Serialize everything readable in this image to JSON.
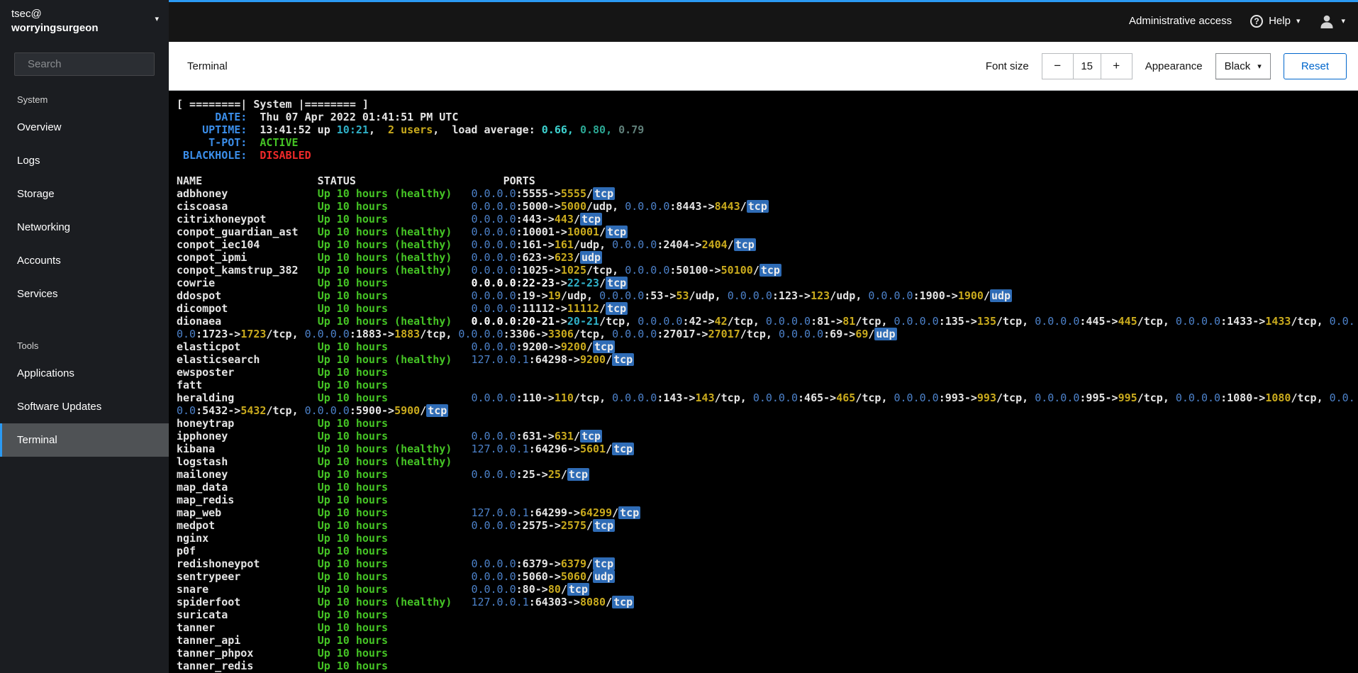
{
  "masthead": {
    "admin_access": "Administrative access",
    "help_label": "Help"
  },
  "sidebar": {
    "host": {
      "user": "tsec@",
      "name": "worryingsurgeon"
    },
    "search_placeholder": "Search",
    "active_item": "Terminal",
    "sections": [
      {
        "label": "System",
        "items": [
          "Overview",
          "Logs",
          "Storage",
          "Networking",
          "Accounts",
          "Services"
        ]
      },
      {
        "label": "Tools",
        "items": [
          "Applications",
          "Software Updates",
          "Terminal"
        ]
      }
    ]
  },
  "toolbar": {
    "title": "Terminal",
    "font_size_label": "Font size",
    "decrease_icon": "−",
    "increase_icon": "+",
    "font_size_value": "15",
    "appearance_label": "Appearance",
    "appearance_value": "Black",
    "reset_label": "Reset"
  },
  "terminal": {
    "banner": "[ ========| System |======== ]",
    "info_rows": [
      {
        "label": "DATE:",
        "segments": [
          {
            "t": "Thu 07 Apr 2022 01:41:51 PM UTC",
            "c": "fg"
          }
        ]
      },
      {
        "label": "UPTIME:",
        "segments": [
          {
            "t": "13:41:52 up ",
            "c": "fg"
          },
          {
            "t": "10:21",
            "c": "cyan"
          },
          {
            "t": ",  ",
            "c": "fg"
          },
          {
            "t": "2 users",
            "c": "yellow"
          },
          {
            "t": ",  load average: ",
            "c": "fg"
          },
          {
            "t": "0.66,",
            "c": "loadA"
          },
          {
            "t": " ",
            "c": "fg"
          },
          {
            "t": "0.80,",
            "c": "loadB"
          },
          {
            "t": " ",
            "c": "fg"
          },
          {
            "t": "0.79",
            "c": "loadC"
          }
        ]
      },
      {
        "label": "T-POT:",
        "segments": [
          {
            "t": "ACTIVE",
            "c": "green"
          }
        ]
      },
      {
        "label": "BLACKHOLE:",
        "segments": [
          {
            "t": "DISABLED",
            "c": "red"
          }
        ]
      }
    ],
    "columns": {
      "name": "NAME",
      "status": "STATUS",
      "ports": "PORTS"
    },
    "containers": [
      {
        "name": "adbhoney",
        "status": "Up 10 hours (healthy)",
        "ports": "0.0.0.0:5555->5555/tcp"
      },
      {
        "name": "ciscoasa",
        "status": "Up 10 hours",
        "ports": "0.0.0.0:5000->5000/udp, 0.0.0.0:8443->8443/tcp"
      },
      {
        "name": "citrixhoneypot",
        "status": "Up 10 hours",
        "ports": "0.0.0.0:443->443/tcp"
      },
      {
        "name": "conpot_guardian_ast",
        "status": "Up 10 hours (healthy)",
        "ports": "0.0.0.0:10001->10001/tcp"
      },
      {
        "name": "conpot_iec104",
        "status": "Up 10 hours (healthy)",
        "ports": "0.0.0.0:161->161/udp, 0.0.0.0:2404->2404/tcp"
      },
      {
        "name": "conpot_ipmi",
        "status": "Up 10 hours (healthy)",
        "ports": "0.0.0.0:623->623/udp"
      },
      {
        "name": "conpot_kamstrup_382",
        "status": "Up 10 hours (healthy)",
        "ports": "0.0.0.0:1025->1025/tcp, 0.0.0.0:50100->50100/tcp"
      },
      {
        "name": "cowrie",
        "status": "Up 10 hours",
        "ports": "0.0.0.0:22-23->22-23/tcp"
      },
      {
        "name": "ddospot",
        "status": "Up 10 hours",
        "ports": "0.0.0.0:19->19/udp, 0.0.0.0:53->53/udp, 0.0.0.0:123->123/udp, 0.0.0.0:1900->1900/udp"
      },
      {
        "name": "dicompot",
        "status": "Up 10 hours",
        "ports": "0.0.0.0:11112->11112/tcp"
      },
      {
        "name": "dionaea",
        "status": "Up 10 hours (healthy)",
        "ports": "0.0.0.0:20-21->20-21/tcp, 0.0.0.0:42->42/tcp, 0.0.0.0:81->81/tcp, 0.0.0.0:135->135/tcp, 0.0.0.0:445->445/tcp, 0.0.0.0:1433->1433/tcp, 0.0.0.0:1723->1723/tcp, 0.0.0.0:1883->1883/tcp, 0.0.0.0:3306->3306/tcp, 0.0.0.0:27017->27017/tcp, 0.0.0.0:69->69/udp"
      },
      {
        "name": "elasticpot",
        "status": "Up 10 hours",
        "ports": "0.0.0.0:9200->9200/tcp"
      },
      {
        "name": "elasticsearch",
        "status": "Up 10 hours (healthy)",
        "ports": "127.0.0.1:64298->9200/tcp"
      },
      {
        "name": "ewsposter",
        "status": "Up 10 hours",
        "ports": ""
      },
      {
        "name": "fatt",
        "status": "Up 10 hours",
        "ports": ""
      },
      {
        "name": "heralding",
        "status": "Up 10 hours",
        "ports": "0.0.0.0:110->110/tcp, 0.0.0.0:143->143/tcp, 0.0.0.0:465->465/tcp, 0.0.0.0:993->993/tcp, 0.0.0.0:995->995/tcp, 0.0.0.0:1080->1080/tcp, 0.0.0.0:5432->5432/tcp, 0.0.0.0:5900->5900/tcp"
      },
      {
        "name": "honeytrap",
        "status": "Up 10 hours",
        "ports": ""
      },
      {
        "name": "ipphoney",
        "status": "Up 10 hours",
        "ports": "0.0.0.0:631->631/tcp"
      },
      {
        "name": "kibana",
        "status": "Up 10 hours (healthy)",
        "ports": "127.0.0.1:64296->5601/tcp"
      },
      {
        "name": "logstash",
        "status": "Up 10 hours (healthy)",
        "ports": ""
      },
      {
        "name": "mailoney",
        "status": "Up 10 hours",
        "ports": "0.0.0.0:25->25/tcp"
      },
      {
        "name": "map_data",
        "status": "Up 10 hours",
        "ports": ""
      },
      {
        "name": "map_redis",
        "status": "Up 10 hours",
        "ports": ""
      },
      {
        "name": "map_web",
        "status": "Up 10 hours",
        "ports": "127.0.0.1:64299->64299/tcp"
      },
      {
        "name": "medpot",
        "status": "Up 10 hours",
        "ports": "0.0.0.0:2575->2575/tcp"
      },
      {
        "name": "nginx",
        "status": "Up 10 hours",
        "ports": ""
      },
      {
        "name": "p0f",
        "status": "Up 10 hours",
        "ports": ""
      },
      {
        "name": "redishoneypot",
        "status": "Up 10 hours",
        "ports": "0.0.0.0:6379->6379/tcp"
      },
      {
        "name": "sentrypeer",
        "status": "Up 10 hours",
        "ports": "0.0.0.0:5060->5060/udp"
      },
      {
        "name": "snare",
        "status": "Up 10 hours",
        "ports": "0.0.0.0:80->80/tcp"
      },
      {
        "name": "spiderfoot",
        "status": "Up 10 hours (healthy)",
        "ports": "127.0.0.1:64303->8080/tcp"
      },
      {
        "name": "suricata",
        "status": "Up 10 hours",
        "ports": ""
      },
      {
        "name": "tanner",
        "status": "Up 10 hours",
        "ports": ""
      },
      {
        "name": "tanner_api",
        "status": "Up 10 hours",
        "ports": ""
      },
      {
        "name": "tanner_phpox",
        "status": "Up 10 hours",
        "ports": ""
      },
      {
        "name": "tanner_redis",
        "status": "Up 10 hours",
        "ports": ""
      }
    ],
    "colors": {
      "fg": "#e5e5e5",
      "bright": "#ffffff",
      "label": "#3b8eea",
      "ip": "#4c81c9",
      "yellow": "#c9aa1d",
      "green": "#45c425",
      "cyan": "#2fb0c7",
      "red": "#ef2929",
      "loadA": "#3dd2cf",
      "loadB": "#2ba793",
      "loadC": "#5f7f79",
      "protoBg": "#2f6cb6",
      "protoFg": "#eeeeee"
    }
  }
}
